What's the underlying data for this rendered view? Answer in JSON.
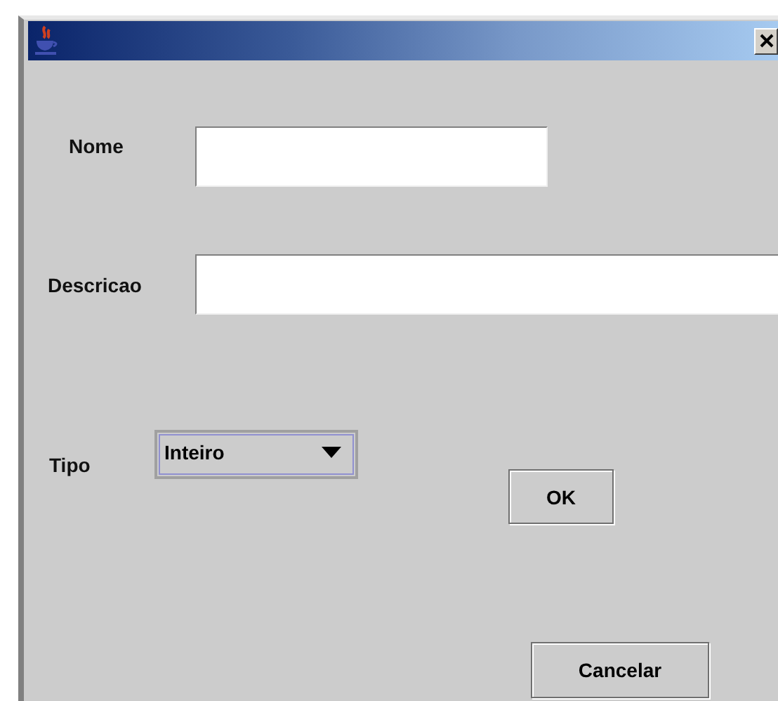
{
  "fields": [
    {
      "label": "Nome",
      "kind": "short"
    },
    {
      "label": "Descricao",
      "kind": "wide"
    }
  ],
  "type_select": {
    "label": "Tipo",
    "value": "Inteiro"
  },
  "buttons": [
    "OK",
    "Cancelar"
  ]
}
